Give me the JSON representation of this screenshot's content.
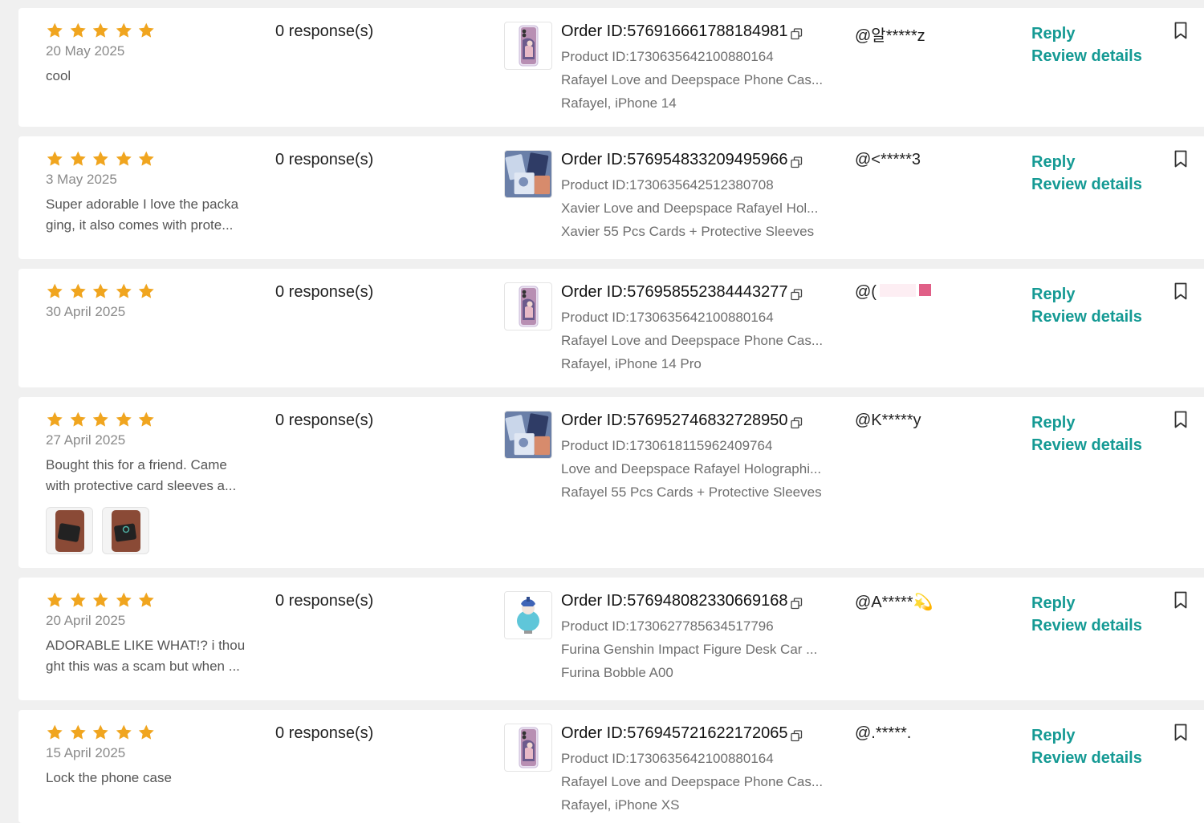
{
  "labels": {
    "responses": "0 response(s)",
    "reply": "Reply",
    "review_details": "Review details",
    "order_prefix": "Order ID:",
    "product_prefix": "Product ID:"
  },
  "colors": {
    "star": "#f0a51f",
    "link": "#159a94",
    "date": "#8a8a8a"
  },
  "reviews": [
    {
      "rating": 5,
      "date": "20 May 2025",
      "text": [
        "cool"
      ],
      "order_id": "576916661788184981",
      "product_id": "1730635642100880164",
      "product_name": "Rafayel Love and Deepspace Phone Cas...",
      "variant": "Rafayel, iPhone 14",
      "buyer": "@알*****z",
      "product_icon": "phone-case-image"
    },
    {
      "rating": 5,
      "date": "3 May 2025",
      "text": [
        "Super adorable I love the packa",
        "ging, it also comes with prote..."
      ],
      "order_id": "576954833209495966",
      "product_id": "1730635642512380708",
      "product_name": "Xavier Love and Deepspace Rafayel Hol...",
      "variant": "Xavier 55 Pcs Cards + Protective Sleeves",
      "buyer": "@<*****3",
      "product_icon": "card-set-image"
    },
    {
      "rating": 5,
      "date": "30 April 2025",
      "text": [],
      "order_id": "576958552384443277",
      "product_id": "1730635642100880164",
      "product_name": "Rafayel Love and Deepspace Phone Cas...",
      "variant": "Rafayel, iPhone 14 Pro",
      "buyer": "@(",
      "product_icon": "phone-case-image"
    },
    {
      "rating": 5,
      "date": "27 April 2025",
      "text": [
        "Bought this for a friend. Came",
        "with protective card sleeves a..."
      ],
      "order_id": "576952746832728950",
      "product_id": "1730618115962409764",
      "product_name": "Love and Deepspace Rafayel Holographi...",
      "variant": "Rafayel 55 Pcs Cards + Protective Sleeves",
      "buyer": "@K*****y",
      "product_icon": "card-set-image",
      "photos": 2
    },
    {
      "rating": 5,
      "date": "20 April 2025",
      "text": [
        "ADORABLE LIKE WHAT!? i thou",
        "ght this was a scam but when ..."
      ],
      "order_id": "576948082330669168",
      "product_id": "1730627785634517796",
      "product_name": "Furina Genshin Impact Figure Desk Car ...",
      "variant": "Furina Bobble A00",
      "buyer": "@A*****💫",
      "product_icon": "figure-image"
    },
    {
      "rating": 5,
      "date": "15 April 2025",
      "text": [
        "Lock the phone case"
      ],
      "order_id": "576945721622172065",
      "product_id": "1730635642100880164",
      "product_name": "Rafayel Love and Deepspace Phone Cas...",
      "variant": "Rafayel, iPhone XS",
      "buyer": "@.*****.",
      "product_icon": "phone-case-image"
    }
  ]
}
